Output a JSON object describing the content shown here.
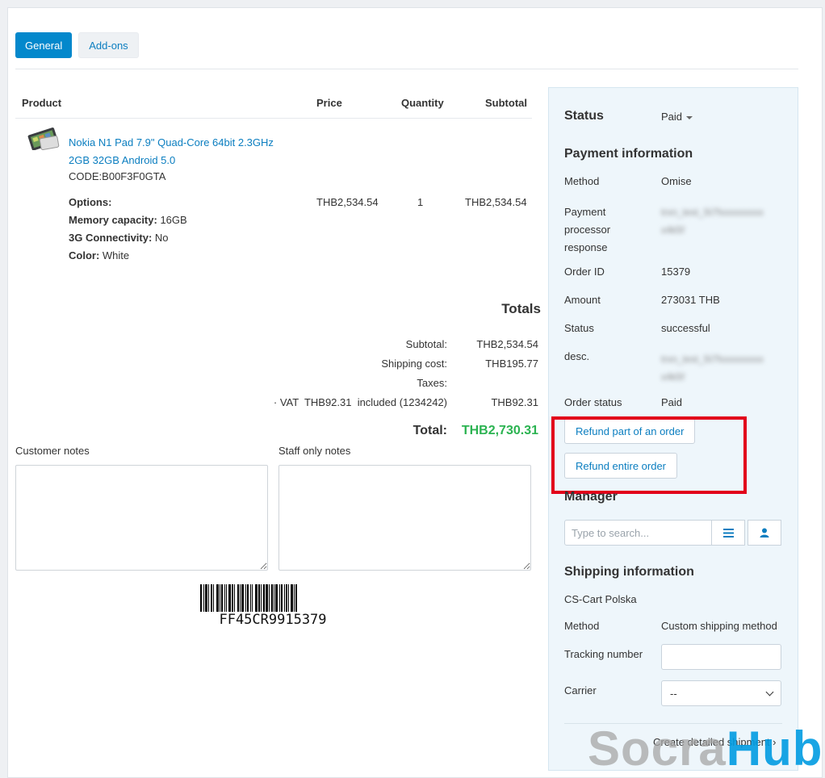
{
  "tabs": [
    {
      "label": "General",
      "active": true
    },
    {
      "label": "Add-ons",
      "active": false
    }
  ],
  "product_table": {
    "headers": {
      "product": "Product",
      "price": "Price",
      "quantity": "Quantity",
      "subtotal": "Subtotal"
    },
    "row": {
      "name_line1": "Nokia N1 Pad 7.9\" Quad-Core 64bit 2.3GHz",
      "name_line2": "2GB 32GB Android 5.0",
      "code": "CODE:B00F3F0GTA",
      "options_label": "Options:",
      "options": [
        {
          "name": "Memory capacity:",
          "value": "16GB"
        },
        {
          "name": "3G Connectivity:",
          "value": "No"
        },
        {
          "name": "Color:",
          "value": "White"
        }
      ],
      "price": "THB2,534.54",
      "quantity": "1",
      "subtotal": "THB2,534.54"
    }
  },
  "totals": {
    "title": "Totals",
    "subtotal_label": "Subtotal:",
    "subtotal_value": "THB2,534.54",
    "shipping_label": "Shipping cost:",
    "shipping_value": "THB195.77",
    "taxes_label": "Taxes:",
    "vat_label": "· VAT  THB92.31  included (1234242)",
    "vat_value": "THB92.31",
    "total_label": "Total:",
    "total_value": "THB2,730.31"
  },
  "notes": {
    "customer_label": "Customer notes",
    "staff_label": "Staff only notes"
  },
  "barcode": {
    "text": "FF45CR9915379"
  },
  "sidebar": {
    "status_label": "Status",
    "status_value": "Paid",
    "payment_heading": "Payment information",
    "method_label": "Method",
    "method_value": "Omise",
    "ppr_label_1": "Payment",
    "ppr_label_2": "processor",
    "ppr_label_3": "response",
    "ppr_value_1": "trxn_test_5t7fxxxxxxxxx",
    "ppr_value_2": "x4k5f",
    "order_id_label": "Order ID",
    "order_id_value": "15379",
    "amount_label": "Amount",
    "amount_value": "273031 THB",
    "pstatus_label": "Status",
    "pstatus_value": "successful",
    "desc_label": "desc.",
    "desc_value_1": "trxn_test_5t7fxxxxxxxxx",
    "desc_value_2": "x4k5f",
    "order_status_label": "Order status",
    "order_status_value": "Paid",
    "refund_part_label": "Refund part of an order",
    "refund_entire_label": "Refund entire order",
    "manager_heading": "Manager",
    "search_placeholder": "Type to search...",
    "shipping_heading": "Shipping information",
    "shipping_company": "CS-Cart Polska",
    "ship_method_label": "Method",
    "ship_method_value": "Custom shipping method",
    "tracking_label": "Tracking number",
    "carrier_label": "Carrier",
    "carrier_value": "--",
    "create_shipment_label": "Create detailed shipment"
  },
  "watermark": {
    "part1": "Socra",
    "part2": "Hub"
  },
  "colors": {
    "accent": "#0388cc",
    "link": "#0b7ec0",
    "total_green": "#2bb351",
    "highlight_red": "#e2001a"
  }
}
